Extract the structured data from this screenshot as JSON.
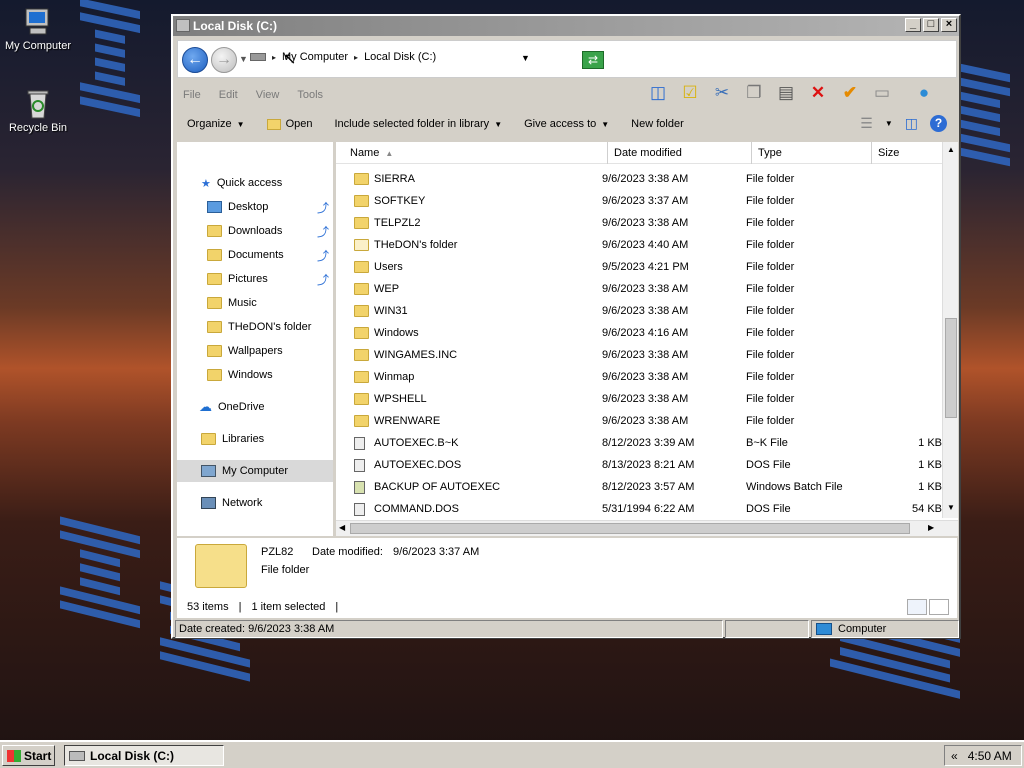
{
  "desktop": {
    "icons": [
      {
        "label": "My Computer"
      },
      {
        "label": "Recycle Bin"
      }
    ]
  },
  "window": {
    "title": "Local Disk (C:)",
    "controls": {
      "minimize": "_",
      "maximize": "□",
      "close": "×"
    }
  },
  "address": {
    "crumbs": [
      "My Computer",
      "Local Disk (C:)"
    ]
  },
  "menu": [
    "File",
    "Edit",
    "View",
    "Tools"
  ],
  "commands": {
    "organize": "Organize",
    "open": "Open",
    "include": "Include selected folder in library",
    "share": "Give access to",
    "new_folder": "New folder"
  },
  "nav": {
    "quick_access": "Quick access",
    "items": [
      "Desktop",
      "Downloads",
      "Documents",
      "Pictures",
      "Music",
      "THeDON's folder",
      "Wallpapers",
      "Windows"
    ],
    "onedrive": "OneDrive",
    "libraries": "Libraries",
    "my_computer": "My Computer",
    "network": "Network"
  },
  "columns": {
    "name": "Name",
    "modified": "Date modified",
    "type": "Type",
    "size": "Size"
  },
  "files": [
    {
      "name": "SIERRA",
      "date": "9/6/2023 3:38 AM",
      "type": "File folder",
      "size": ""
    },
    {
      "name": "SOFTKEY",
      "date": "9/6/2023 3:37 AM",
      "type": "File folder",
      "size": ""
    },
    {
      "name": "TELPZL2",
      "date": "9/6/2023 3:38 AM",
      "type": "File folder",
      "size": ""
    },
    {
      "name": "THeDON's folder",
      "date": "9/6/2023 4:40 AM",
      "type": "File folder",
      "size": ""
    },
    {
      "name": "Users",
      "date": "9/5/2023 4:21 PM",
      "type": "File folder",
      "size": ""
    },
    {
      "name": "WEP",
      "date": "9/6/2023 3:38 AM",
      "type": "File folder",
      "size": ""
    },
    {
      "name": "WIN31",
      "date": "9/6/2023 3:38 AM",
      "type": "File folder",
      "size": ""
    },
    {
      "name": "Windows",
      "date": "9/6/2023 4:16 AM",
      "type": "File folder",
      "size": ""
    },
    {
      "name": "WINGAMES.INC",
      "date": "9/6/2023 3:38 AM",
      "type": "File folder",
      "size": ""
    },
    {
      "name": "Winmap",
      "date": "9/6/2023 3:38 AM",
      "type": "File folder",
      "size": ""
    },
    {
      "name": "WPSHELL",
      "date": "9/6/2023 3:38 AM",
      "type": "File folder",
      "size": ""
    },
    {
      "name": "WRENWARE",
      "date": "9/6/2023 3:38 AM",
      "type": "File folder",
      "size": ""
    },
    {
      "name": "AUTOEXEC.B~K",
      "date": "8/12/2023 3:39 AM",
      "type": "B~K File",
      "size": "1 KB"
    },
    {
      "name": "AUTOEXEC.DOS",
      "date": "8/13/2023 8:21 AM",
      "type": "DOS File",
      "size": "1 KB"
    },
    {
      "name": "BACKUP OF AUTOEXEC",
      "date": "8/12/2023 3:57 AM",
      "type": "Windows Batch File",
      "size": "1 KB"
    },
    {
      "name": "COMMAND.DOS",
      "date": "5/31/1994 6:22 AM",
      "type": "DOS File",
      "size": "54 KB"
    }
  ],
  "details": {
    "name": "PZL82",
    "modified_label": "Date modified:",
    "modified": "9/6/2023 3:37 AM",
    "type": "File folder"
  },
  "counts": {
    "items": "53 items",
    "selected": "1 item selected"
  },
  "status": {
    "created": "Date created: 9/6/2023 3:38 AM",
    "location": "Computer"
  },
  "taskbar": {
    "start": "Start",
    "task": "Local Disk (C:)",
    "tray_arrows": "«",
    "clock": "4:50 AM"
  }
}
